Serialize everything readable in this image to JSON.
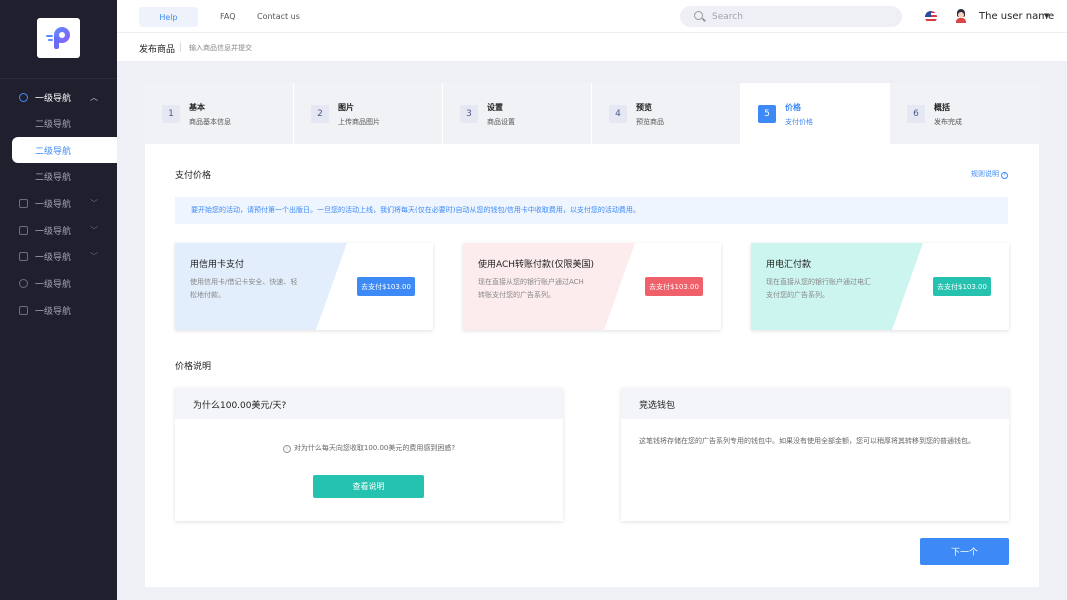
{
  "sidebar": {
    "logo": "P",
    "items": [
      {
        "label": "一级导航",
        "chevron": "^"
      },
      {
        "label": "二级导航"
      },
      {
        "label": "二级导航"
      },
      {
        "label": "二级导航"
      },
      {
        "label": "一级导航",
        "chevron": "v"
      },
      {
        "label": "一级导航",
        "chevron": "v"
      },
      {
        "label": "一级导航",
        "chevron": "v"
      },
      {
        "label": "一级导航"
      },
      {
        "label": "一级导航"
      }
    ]
  },
  "header": {
    "help": "Help",
    "faq": "FAQ",
    "contact": "Contact us",
    "search_placeholder": "Search",
    "username": "The user name"
  },
  "titlebar": {
    "title": "发布商品",
    "subtitle": "输入商品信息并提交"
  },
  "steps": [
    {
      "num": "1",
      "title": "基本",
      "sub": "商品基本信息"
    },
    {
      "num": "2",
      "title": "图片",
      "sub": "上传商品图片"
    },
    {
      "num": "3",
      "title": "设置",
      "sub": "商品设置"
    },
    {
      "num": "4",
      "title": "预览",
      "sub": "预览商品"
    },
    {
      "num": "5",
      "title": "价格",
      "sub": "支付价格"
    },
    {
      "num": "6",
      "title": "概括",
      "sub": "发布完成"
    }
  ],
  "main": {
    "pay_title": "支付价格",
    "rules_link": "规则说明",
    "notice": "要开始您的活动，请预付第一个出版日。一旦您的活动上线，我们将每天(仅在必要时)自动从您的钱包/信用卡中收取费用，以支付您的活动费用。",
    "pay_cards": [
      {
        "title": "用信用卡支付",
        "desc": "使用信用卡/借记卡安全、快速、轻松地付款。",
        "button": "去支付$103.00",
        "band": "#e3eefc",
        "btn_color": "#3d8af7"
      },
      {
        "title": "使用ACH转账付款(仅限美国)",
        "desc": "现在直接从您的银行账户通过ACH转账支付您的广告系列。",
        "button": "去支付$103.00",
        "band": "#fdeced",
        "btn_color": "#f0606a"
      },
      {
        "title": "用电汇付款",
        "desc": "现在直接从您的银行账户通过电汇支付您的广告系列。",
        "button": "去支付$103.00",
        "band": "#cdf5ef",
        "btn_color": "#26c2b0"
      }
    ],
    "price_title": "价格说明",
    "why_card": {
      "title": "为什么100.00美元/天?",
      "question": "对为什么每天向您收取100.00美元的费用感到困惑?",
      "button": "查看说明"
    },
    "wallet_card": {
      "title": "竞选钱包",
      "desc": "这笔钱将存储在您的广告系列专用的钱包中。如果没有使用全部金额，您可以稍厚将其转移到您的普通钱包。"
    },
    "next": "下一个"
  }
}
